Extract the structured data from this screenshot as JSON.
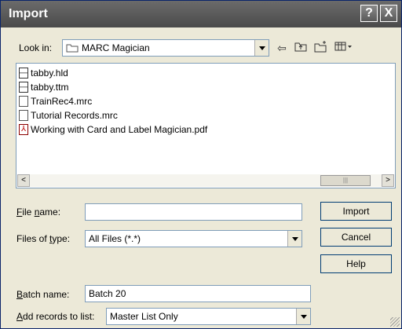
{
  "window": {
    "title": "Import",
    "help_label": "?",
    "close_label": "X"
  },
  "look_in": {
    "label": "Look in:",
    "value": "MARC Magician"
  },
  "files": [
    {
      "name": "tabby.hld",
      "icon": "data-file-icon"
    },
    {
      "name": "tabby.ttm",
      "icon": "data-file-icon"
    },
    {
      "name": "TrainRec4.mrc",
      "icon": "document-icon"
    },
    {
      "name": "Tutorial Records.mrc",
      "icon": "document-icon"
    },
    {
      "name": "Working with Card and Label Magician.pdf",
      "icon": "pdf-icon"
    }
  ],
  "file_name": {
    "label": "File name:",
    "value": ""
  },
  "files_of_type": {
    "label": "Files of type:",
    "value": "All Files (*.*)"
  },
  "batch_name": {
    "label": "Batch name:",
    "value": "Batch 20"
  },
  "add_records": {
    "label": "Add records to list:",
    "value": "Master List Only"
  },
  "buttons": {
    "import": "Import",
    "cancel": "Cancel",
    "help": "Help"
  },
  "scroll": {
    "left": "<",
    "right": ">",
    "thumb_grip": "|||"
  }
}
